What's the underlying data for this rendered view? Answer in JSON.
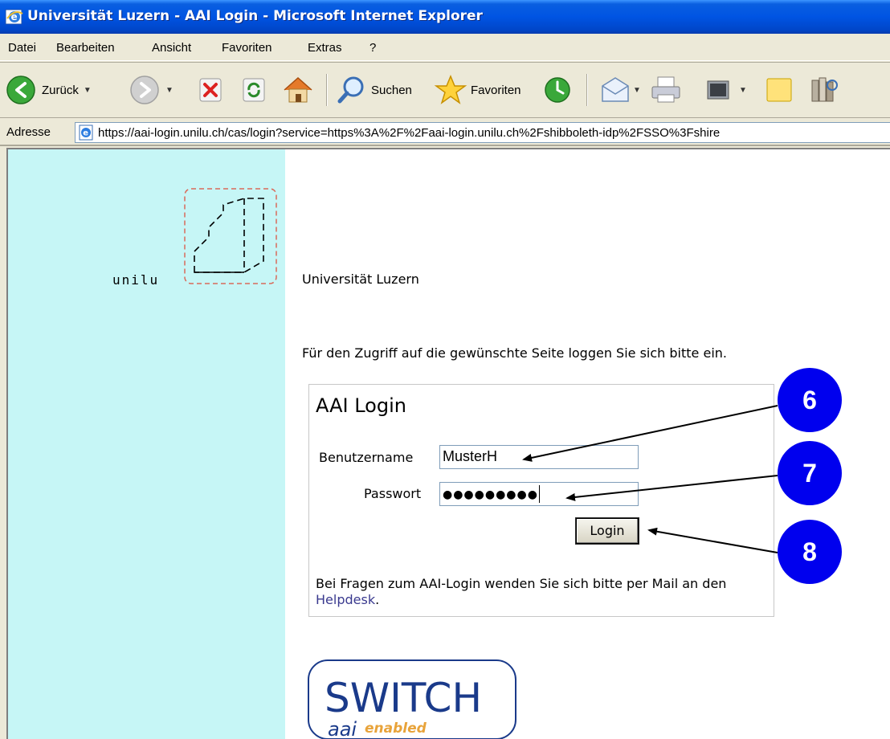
{
  "window": {
    "title": "Universität Luzern - AAI Login - Microsoft Internet Explorer"
  },
  "menu": {
    "items": [
      "Datei",
      "Bearbeiten",
      "Ansicht",
      "Favoriten",
      "Extras",
      "?"
    ]
  },
  "toolbar": {
    "back_label": "Zurück",
    "search_label": "Suchen",
    "favorites_label": "Favoriten"
  },
  "address": {
    "label": "Adresse",
    "url": "https://aai-login.unilu.ch/cas/login?service=https%3A%2F%2Faai-login.unilu.ch%2Fshibboleth-idp%2FSSO%3Fshire"
  },
  "page": {
    "logo_text": "unilu",
    "university_name": "Universität Luzern",
    "intro_text": "Für den Zugriff auf die gewünschte Seite loggen Sie sich bitte ein.",
    "login": {
      "title": "AAI Login",
      "username_label": "Benutzername",
      "username_value": "MusterH",
      "password_label": "Passwort",
      "password_mask": "●●●●●●●●●",
      "button_label": "Login"
    },
    "help": {
      "text_before": "Bei Fragen zum AAI-Login wenden Sie sich bitte per Mail an den ",
      "link_text": "Helpdesk",
      "text_after": "."
    },
    "switch_logo": {
      "main": "SWITCH",
      "sub1": "aai",
      "sub2": "enabled"
    }
  },
  "callouts": [
    "6",
    "7",
    "8"
  ],
  "colors": {
    "sidebar": "#c6f6f6",
    "callout": "#0000ee",
    "titlebar": "#0054e3",
    "switch_blue": "#1a3a8a",
    "switch_orange": "#e8a33a"
  }
}
